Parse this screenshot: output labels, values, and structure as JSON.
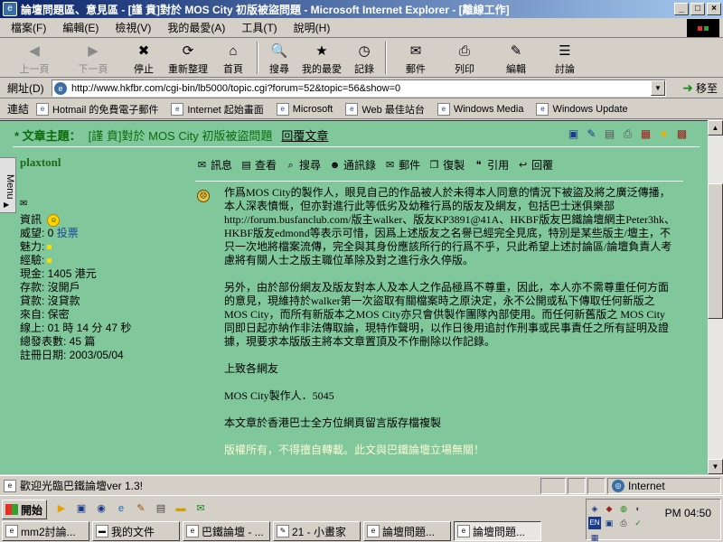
{
  "window": {
    "title": "論壇問題區、意見區 - [謹 賁]對於 MOS City 初版被盜問題 - Microsoft Internet Explorer - [離線工作]",
    "controls": [
      "_",
      "□",
      "×"
    ]
  },
  "menu": [
    "檔案(F)",
    "編輯(E)",
    "檢視(V)",
    "我的最愛(A)",
    "工具(T)",
    "說明(H)"
  ],
  "toolbar": [
    {
      "label": "上一頁",
      "icon": "back-arrow-icon",
      "glyph": "◀",
      "disabled": true
    },
    {
      "label": "下一頁",
      "icon": "forward-arrow-icon",
      "glyph": "▶",
      "disabled": true
    },
    {
      "label": "停止",
      "icon": "stop-icon",
      "glyph": "✖",
      "disabled": false
    },
    {
      "label": "重新整理",
      "icon": "refresh-icon",
      "glyph": "⟳",
      "disabled": false
    },
    {
      "label": "首頁",
      "icon": "home-icon",
      "glyph": "⌂",
      "disabled": false
    },
    {
      "label": "搜尋",
      "icon": "search-icon",
      "glyph": "🔍",
      "disabled": false
    },
    {
      "label": "我的最愛",
      "icon": "favorites-icon",
      "glyph": "★",
      "disabled": false
    },
    {
      "label": "記錄",
      "icon": "history-icon",
      "glyph": "◷",
      "disabled": false
    },
    {
      "label": "郵件",
      "icon": "mail-icon",
      "glyph": "✉",
      "disabled": false
    },
    {
      "label": "列印",
      "icon": "print-icon",
      "glyph": "⎙",
      "disabled": false
    },
    {
      "label": "編輯",
      "icon": "edit-icon",
      "glyph": "✎",
      "disabled": false
    },
    {
      "label": "討論",
      "icon": "discuss-icon",
      "glyph": "☰",
      "disabled": false
    }
  ],
  "address": {
    "label": "網址(D)",
    "url": "http://www.hkfbr.com/cgi-bin/lb5000/topic.cgi?forum=52&topic=56&show=0",
    "go_label": "移至"
  },
  "links": {
    "label": "連結",
    "items": [
      "Hotmail 的免費電子郵件",
      "Internet 起始畫面",
      "Microsoft",
      "Web 最佳站台",
      "Windows Media",
      "Windows Update"
    ]
  },
  "topic": {
    "label": "* 文章主題：",
    "subject": "[謹 賁]對於 MOS City 初版被盜問題",
    "reply_label": "回覆文章"
  },
  "sidebar_tab": "Menu",
  "author": {
    "name": "plaxtonl",
    "info": [
      "資訊",
      "威望: 0",
      "投票",
      "魅力:",
      "經驗:",
      "現金: 1405 港元",
      "存款: 沒開戶",
      "貸款: 沒貸款",
      "來自: 保密",
      "線上: 01 時 14 分 47 秒",
      "總發表數: 45 篇",
      "註冊日期: 2003/05/04"
    ]
  },
  "post_actions": [
    "訊息",
    "查看",
    "搜尋",
    "通訊錄",
    "郵件",
    "復製",
    "引用",
    "回覆"
  ],
  "post": {
    "paragraphs": [
      "作爲MOS City的製作人，眼見自己的作品被人於未得本人同意的情況下被盜及將之廣泛傳播，本人深表憤慨，但亦對進行此等低劣及幼稚行爲的版友及網友，包括巴士迷俱樂部 http://forum.busfanclub.com/版主walker、版友KP3891@41A、HKBF版友巴鐵論壇網主Peter3hk、HKBF版友edmond等表示可惜，因爲上述版友之名譽已經完全見底，特別是某些版主/壇主，不只一次地將檔案流傳，完全與其身份應該所行的行爲不乎，只此希望上述討論區/論壇負責人考慮將有關人士之版主職位革除及對之進行永久停版。",
      "另外，由於部份網友及版友對本人及本人之作品極爲不尊重，因此，本人亦不需尊重任何方面的意見，現維持於walker第一次盜取有關檔案時之原決定，永不公開或私下傳取任何新版之 MOS City，而所有新版本之MOS City亦只會供製作團隊內部使用。而任何新舊版之 MOS City 同即日起亦納作非法傳取論，現特作聲明，以作日後用追討作刑事或民事責任之所有証明及證據，現要求本版版主將本文章置頂及不作刪除以作記錄。",
      "上致各網友",
      "MOS City製作人．5045",
      "本文章於香港巴士全方位網頁留言版存檔複製",
      "版權所有，不得擅自轉載。此文與巴鐵論壇立場無關！"
    ]
  },
  "status": {
    "text": "歡迎光臨巴鐵論壇ver 1.3!",
    "zone": "Internet"
  },
  "taskbar": {
    "start_label": "開始",
    "tasks": [
      "mm2討論...",
      "我的文件",
      "巴鐵論壇 - ...",
      "21 - 小畫家",
      "論壇問題...",
      "論壇問題..."
    ],
    "active_index": 5,
    "clock": "PM 04:50"
  },
  "colors": {
    "page_bg": "#81c79c",
    "title_bar": "#0a246a",
    "topic_green": "#0b6b0b"
  }
}
